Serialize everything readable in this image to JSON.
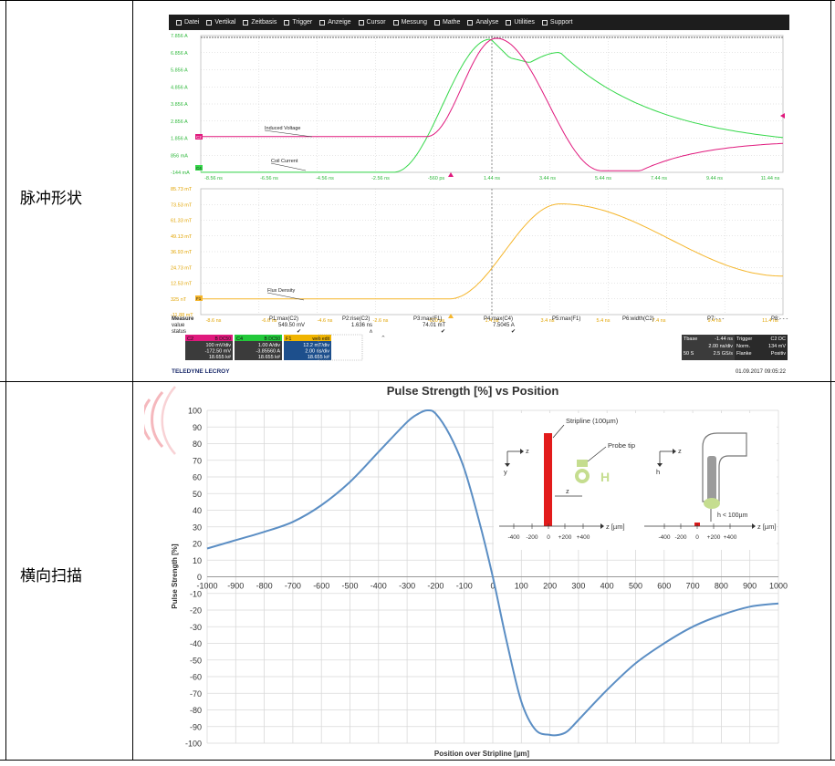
{
  "table": {
    "rows": [
      {
        "label": "脉冲形状"
      },
      {
        "label": "横向扫描"
      }
    ]
  },
  "scope": {
    "menu": [
      {
        "label": "Datei",
        "icon": "file-icon"
      },
      {
        "label": "Vertikal",
        "icon": "vertical-icon"
      },
      {
        "label": "Zeitbasis",
        "icon": "timebase-icon"
      },
      {
        "label": "Trigger",
        "icon": "trigger-icon"
      },
      {
        "label": "Anzeige",
        "icon": "display-icon"
      },
      {
        "label": "Cursor",
        "icon": "cursor-icon"
      },
      {
        "label": "Messung",
        "icon": "measure-icon"
      },
      {
        "label": "Mathe",
        "icon": "math-icon"
      },
      {
        "label": "Analyse",
        "icon": "analysis-icon"
      },
      {
        "label": "Utilities",
        "icon": "utilities-icon"
      },
      {
        "label": "Support",
        "icon": "info-icon"
      }
    ],
    "grid1": {
      "y_ticks": [
        "7.856 A",
        "6.856 A",
        "5.856 A",
        "4.856 A",
        "3.856 A",
        "2.856 A",
        "1.856 A",
        "856 mA",
        "-144 mA"
      ],
      "x_ticks": [
        "-8.56 ns",
        "-6.56 ns",
        "-4.56 ns",
        "-2.56 ns",
        "-560 ps",
        "1.44 ns",
        "3.44 ns",
        "5.44 ns",
        "7.44 ns",
        "9.44 ns",
        "11.44 ns"
      ],
      "labels": {
        "induced": "Induced Voltage",
        "coil": "Coil Current"
      },
      "markers": {
        "c2": "C2",
        "c4": "C4"
      }
    },
    "grid2": {
      "y_ticks": [
        "85.73 mT",
        "73.53 mT",
        "61.33 mT",
        "49.13 mT",
        "36.93 mT",
        "24.73 mT",
        "12.53 mT",
        "325 nT",
        "-11.88 mT"
      ],
      "x_ticks": [
        "-8.6 ns",
        "-6.6 ns",
        "-4.6 ns",
        "-2.6 ns",
        "-600 ps",
        "1.4 ns",
        "3.4 ns",
        "5.4 ns",
        "7.4 ns",
        "9.4 ns",
        "11.4 ns"
      ],
      "labels": {
        "flux": "Flux Density"
      },
      "markers": {
        "f1": "F1"
      }
    },
    "measure": {
      "headers": [
        "Measure",
        "P1:max(C2)",
        "P2:rise(C2)",
        "P3:max(F1)",
        "P4:max(C4)",
        "P5:max(F1)",
        "P6:width(C2)",
        "P7:- - -",
        "P8:- - -"
      ],
      "value_label": "value",
      "status_label": "status",
      "values": [
        "549.50 mV",
        "1.636 ns",
        "74.01 mT",
        "7.5045 A"
      ],
      "status": [
        "✔",
        "ᴧ",
        "✔",
        "✔"
      ]
    },
    "channels": [
      {
        "name": "C2",
        "badges": "B DC50",
        "lines": [
          "100 mV/div",
          "-172.50 mV",
          "18.655 k#"
        ],
        "color": "#e0197d"
      },
      {
        "name": "C4",
        "badges": "B DC50",
        "lines": [
          "1.00 A/div",
          "-3.85560 A",
          "18.655 k#"
        ],
        "color": "#22c93a"
      },
      {
        "name": "F1",
        "badges": "web edit",
        "lines": [
          "12.2 mT/div",
          "2.00 ns/div",
          "18.655 k#"
        ],
        "color": "#f0b400"
      }
    ],
    "timebase": {
      "rows": [
        [
          "Tbase",
          "-1.44 ns",
          "Trigger",
          "C2 DC"
        ],
        [
          "",
          "2.00 ns/div",
          "Norm.",
          "134 mV"
        ],
        [
          "50 S",
          "2.5 GS/s",
          "Flanke",
          "Positiv"
        ]
      ]
    },
    "brand": "TELEDYNE LECROY",
    "datetime": "01.09.2017 09:05:22",
    "colors": {
      "c2": "#e0197d",
      "c4": "#35d84a",
      "f1": "#f5b62c"
    }
  },
  "sweep_chart": {
    "title": "Pulse Strength [%] vs Position",
    "xlabel": "Position over Stripline [µm]",
    "ylabel": "Pulse Strength [%]",
    "y_ticks": [
      "100",
      "90",
      "80",
      "70",
      "60",
      "50",
      "40",
      "30",
      "20",
      "10",
      "0",
      "-10",
      "-20",
      "-30",
      "-40",
      "-50",
      "-60",
      "-70",
      "-80",
      "-90",
      "-100"
    ],
    "x_ticks": [
      "-1000",
      "-900",
      "-800",
      "-700",
      "-600",
      "-500",
      "-400",
      "-300",
      "-200",
      "-100",
      "0",
      "100",
      "200",
      "300",
      "400",
      "500",
      "600",
      "700",
      "800",
      "900",
      "1000"
    ],
    "inset": {
      "stripline": "Stripline (100µm)",
      "probe_tip": "Probe tip",
      "z_axis": "z [µm]",
      "ticks": [
        "-400",
        "-200",
        "0",
        "+200",
        "+400"
      ],
      "height_note": "h < 100µm",
      "labels": {
        "z": "z",
        "y": "y",
        "h": "h"
      }
    }
  },
  "chart_data": {
    "type": "line",
    "title": "Pulse Strength [%] vs Position",
    "xlabel": "Position over Stripline [µm]",
    "ylabel": "Pulse Strength [%]",
    "xlim": [
      -1000,
      1000
    ],
    "ylim": [
      -100,
      100
    ],
    "grid": true,
    "x": [
      -1000,
      -900,
      -800,
      -700,
      -600,
      -500,
      -400,
      -300,
      -260,
      -230,
      -200,
      -150,
      -100,
      -50,
      0,
      50,
      100,
      150,
      200,
      230,
      260,
      300,
      400,
      500,
      600,
      700,
      800,
      900,
      1000
    ],
    "values": [
      17,
      22,
      27,
      33,
      43,
      57,
      75,
      93,
      98,
      100,
      98,
      85,
      65,
      35,
      0,
      -40,
      -75,
      -92,
      -95,
      -95,
      -93,
      -86,
      -68,
      -52,
      -40,
      -30,
      -23,
      -18,
      -16
    ]
  }
}
